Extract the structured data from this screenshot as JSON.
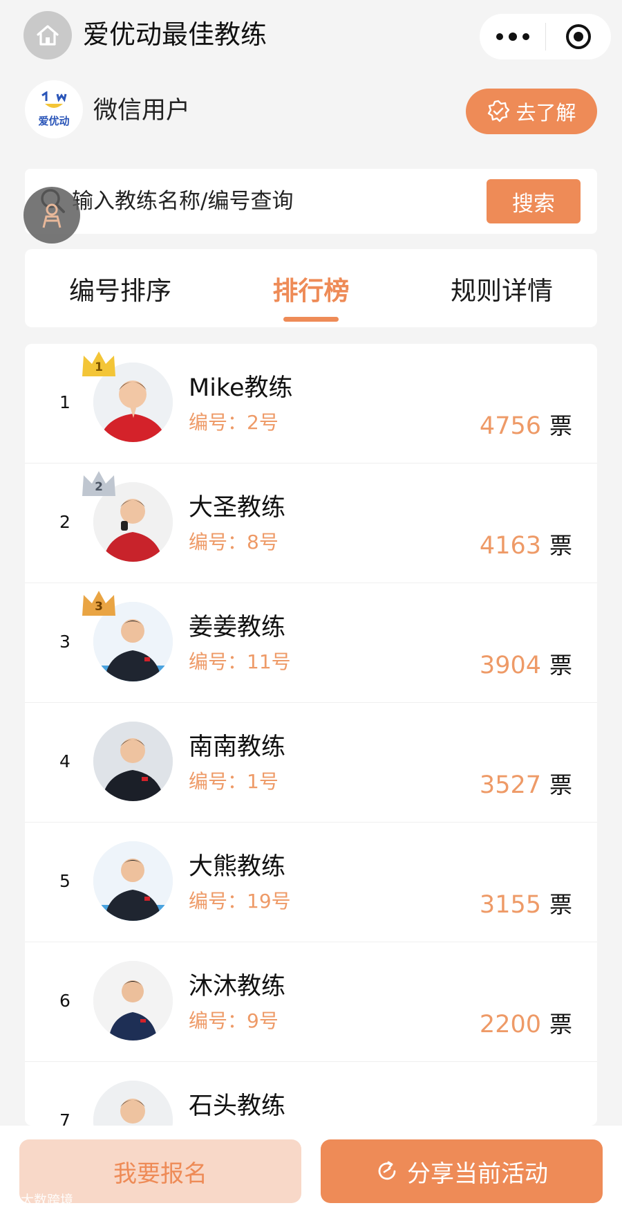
{
  "header": {
    "title": "爱优动最佳教练"
  },
  "user": {
    "logo_text": "爱优动",
    "name": "微信用户",
    "learn_more_label": "去了解"
  },
  "search": {
    "placeholder": "输入教练名称/编号查询",
    "button_label": "搜索"
  },
  "tabs": [
    {
      "label": "编号排序",
      "active": false
    },
    {
      "label": "排行榜",
      "active": true
    },
    {
      "label": "规则详情",
      "active": false
    }
  ],
  "ranking": [
    {
      "rank": "1",
      "name": "Mike教练",
      "number": "编号：2号",
      "votes": "4756",
      "unit": "票",
      "crown": "1"
    },
    {
      "rank": "2",
      "name": "大圣教练",
      "number": "编号：8号",
      "votes": "4163",
      "unit": "票",
      "crown": "2"
    },
    {
      "rank": "3",
      "name": "姜姜教练",
      "number": "编号：11号",
      "votes": "3904",
      "unit": "票",
      "crown": "3"
    },
    {
      "rank": "4",
      "name": "南南教练",
      "number": "编号：1号",
      "votes": "3527",
      "unit": "票",
      "crown": ""
    },
    {
      "rank": "5",
      "name": "大熊教练",
      "number": "编号：19号",
      "votes": "3155",
      "unit": "票",
      "crown": ""
    },
    {
      "rank": "6",
      "name": "沐沐教练",
      "number": "编号：9号",
      "votes": "2200",
      "unit": "票",
      "crown": ""
    },
    {
      "rank": "7",
      "name": "石头教练",
      "number": "",
      "votes": "",
      "unit": "",
      "crown": ""
    }
  ],
  "bottom": {
    "signup_label": "我要报名",
    "share_label": "分享当前活动"
  },
  "watermark": "大数跨境",
  "colors": {
    "accent": "#ee8b57",
    "accent_light": "#f8d8c8",
    "vote_number": "#ee9a67",
    "gold": "#f3c537",
    "silver": "#bfc6d0",
    "bronze": "#e9a443"
  },
  "icons": {
    "home": "home-icon",
    "more": "more-dots-icon",
    "close": "target-close-icon",
    "badge": "badge-check-icon",
    "search": "search-icon",
    "share": "share-refresh-icon"
  }
}
